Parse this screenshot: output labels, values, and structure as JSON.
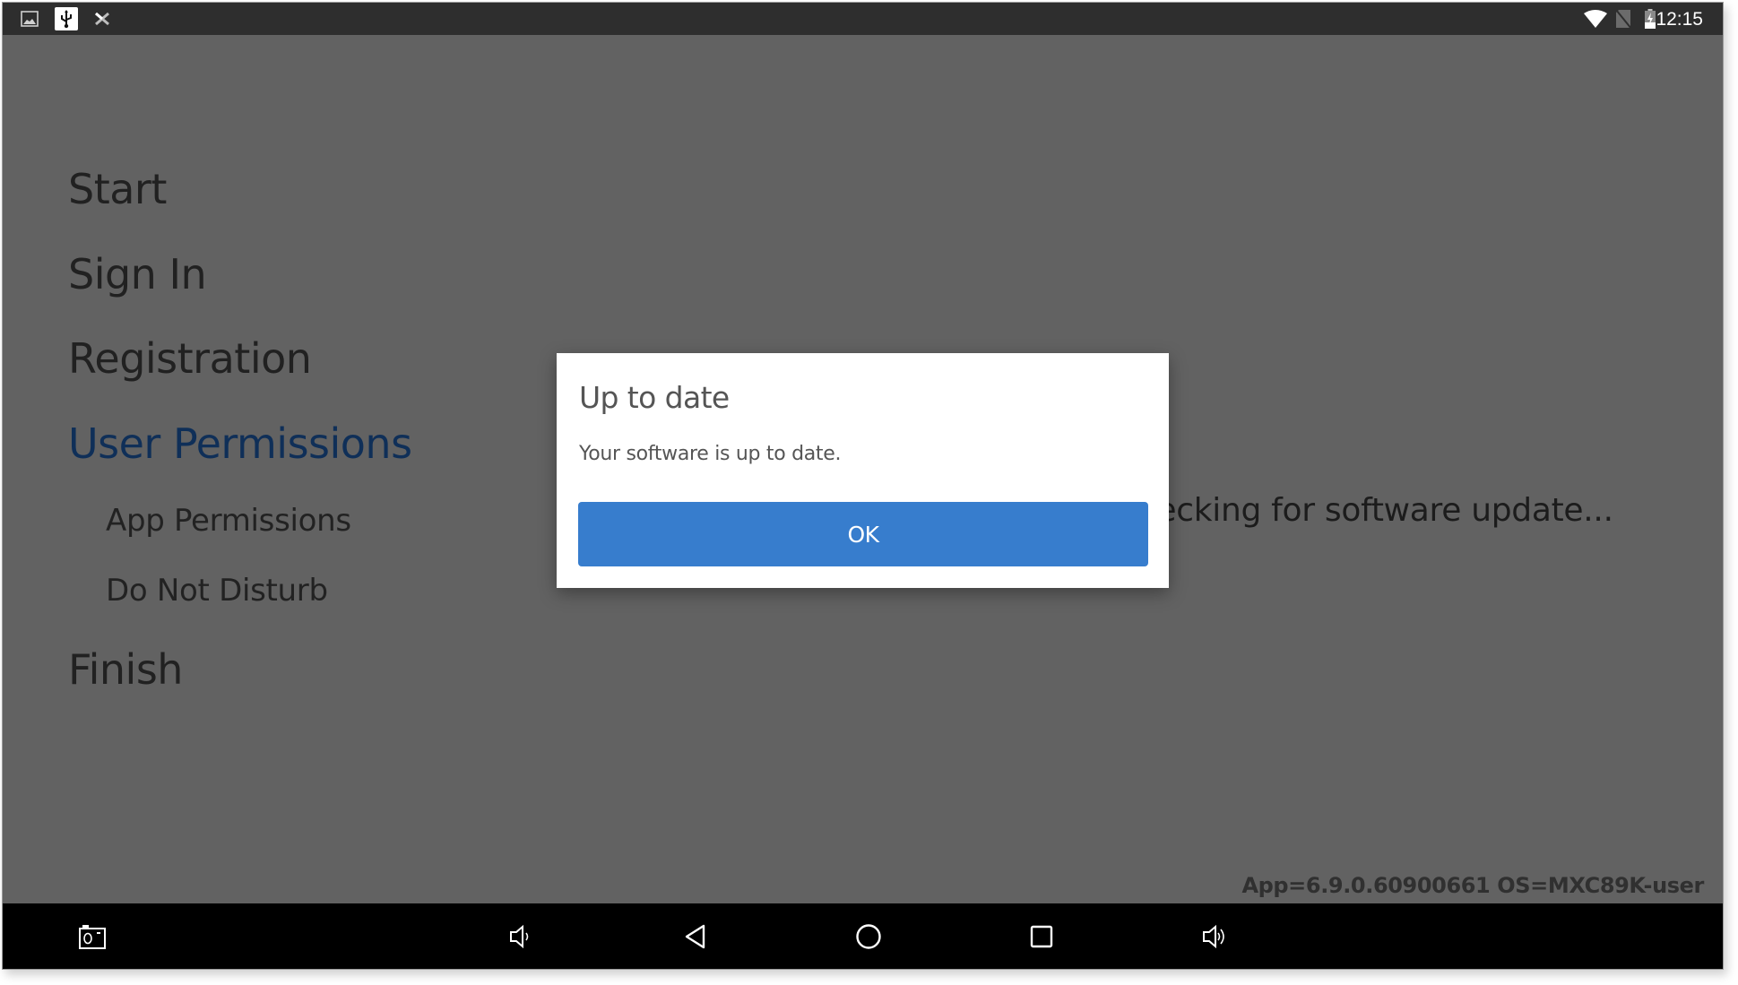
{
  "status_bar": {
    "left_icons": [
      "image-notification-icon",
      "usb-icon",
      "no-signal-tool-icon"
    ],
    "right_icons": [
      "wifi-icon",
      "no-sim-icon",
      "battery-charging-icon"
    ],
    "time": "12:15"
  },
  "menu": {
    "items": [
      {
        "label": "Start",
        "active": false
      },
      {
        "label": "Sign In",
        "active": false
      },
      {
        "label": "Registration",
        "active": false
      },
      {
        "label": "User Permissions",
        "active": true
      }
    ],
    "sub_items": [
      {
        "label": "App Permissions"
      },
      {
        "label": "Do Not Disturb"
      }
    ],
    "final_item": {
      "label": "Finish",
      "active": false
    },
    "active_color": "#1c5cae"
  },
  "background_status": {
    "text": "Checking for software update...",
    "visible_text": "ftware update..."
  },
  "version_info": "App=6.9.0.60900661 OS=MXC89K-user",
  "dialog": {
    "title": "Up to date",
    "message": "Your software is up to date.",
    "ok_label": "OK",
    "button_color": "#377dcd"
  },
  "nav_bar": {
    "buttons": [
      "screenshot-icon",
      "volume-down-icon",
      "back-icon",
      "home-icon",
      "recents-icon",
      "volume-up-icon"
    ]
  }
}
